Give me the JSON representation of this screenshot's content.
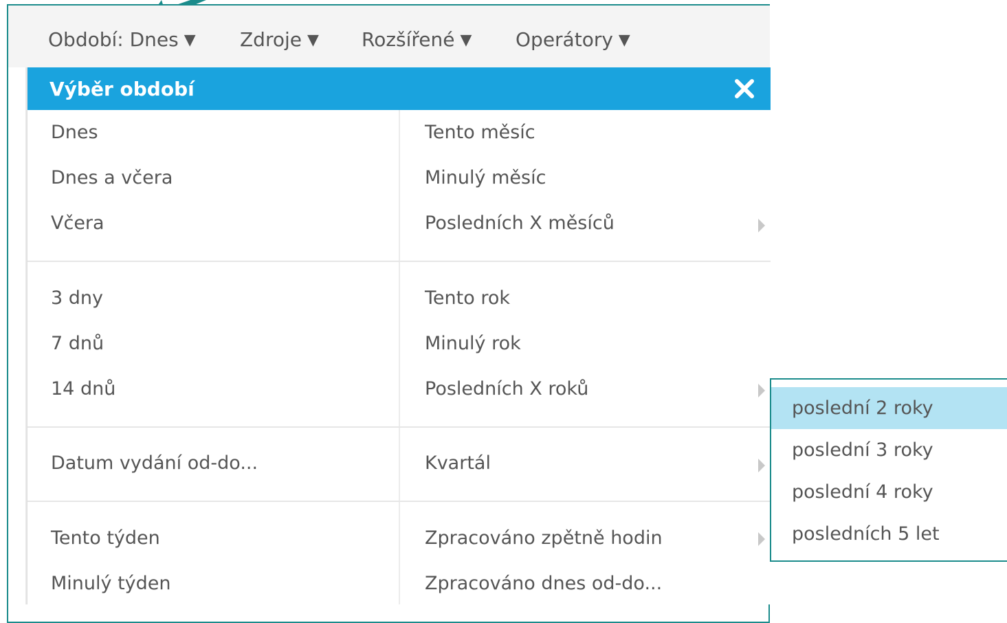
{
  "toolbar": {
    "period_label": "Období: Dnes",
    "sources_label": "Zdroje",
    "advanced_label": "Rozšířené",
    "operators_label": "Operátory",
    "caret": "▼"
  },
  "panel": {
    "title": "Výběr období",
    "close_glyph": "✕",
    "left_column": {
      "group1": [
        "Dnes",
        "Dnes a včera",
        "Včera"
      ],
      "group2": [
        "3 dny",
        "7 dnů",
        "14 dnů"
      ],
      "group3": [
        "Datum vydání od-do..."
      ],
      "group4": [
        "Tento týden",
        "Minulý týden"
      ]
    },
    "right_column": {
      "group1": [
        "Tento měsíc",
        "Minulý měsíc",
        "Posledních X měsíců"
      ],
      "group2": [
        "Tento rok",
        "Minulý rok",
        "Posledních X roků"
      ],
      "group3": [
        "Kvartál"
      ],
      "group4": [
        "Zpracováno zpětně hodin",
        "Zpracováno dnes od-do..."
      ]
    }
  },
  "submenu": {
    "items": [
      "poslední 2 roky",
      "poslední 3 roky",
      "poslední 4 roky",
      "posledních 5 let"
    ],
    "active_index": 0
  },
  "colors": {
    "header_blue": "#1aa3de",
    "frame_teal": "#1a8b8b",
    "active_highlight": "#b3e3f3",
    "text_gray": "#555555"
  }
}
